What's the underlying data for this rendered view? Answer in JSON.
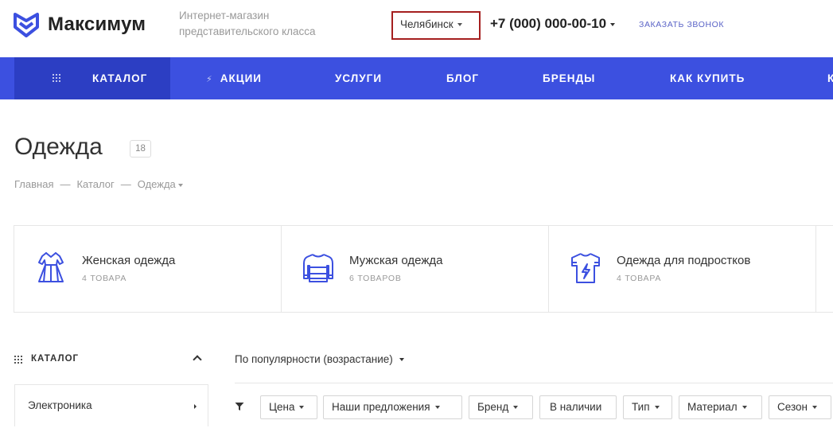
{
  "header": {
    "logo_text": "Максимум",
    "tagline": "Интернет-магазин представительского класса",
    "city": "Челябинск",
    "phone": "+7 (000) 000-00-10",
    "callback": "ЗАКАЗАТЬ ЗВОНОК"
  },
  "nav": {
    "items": [
      {
        "label": "КАТАЛОГ",
        "icon": "grid-icon"
      },
      {
        "label": "АКЦИИ",
        "icon": "lightning-icon"
      },
      {
        "label": "УСЛУГИ"
      },
      {
        "label": "БЛОГ"
      },
      {
        "label": "БРЕНДЫ"
      },
      {
        "label": "КАК КУПИТЬ"
      },
      {
        "label": "К"
      }
    ]
  },
  "page": {
    "title": "Одежда",
    "count": "18"
  },
  "breadcrumb": {
    "items": [
      "Главная",
      "Каталог",
      "Одежда"
    ],
    "separator": "—"
  },
  "categories": [
    {
      "title": "Женская одежда",
      "count": "4 ТОВАРА",
      "icon": "dress-icon"
    },
    {
      "title": "Мужская одежда",
      "count": "6 ТОВАРОВ",
      "icon": "sweater-icon"
    },
    {
      "title": "Одежда для подростков",
      "count": "4 ТОВАРА",
      "icon": "tshirt-icon"
    }
  ],
  "sidebar": {
    "title": "КАТАЛОГ",
    "items": [
      {
        "label": "Электроника"
      }
    ]
  },
  "sort": {
    "label": "По популярности (возрастание)"
  },
  "filters": [
    "Цена",
    "Наши предложения",
    "Бренд",
    "В наличии",
    "Тип",
    "Материал",
    "Сезон"
  ],
  "colors": {
    "nav_bg": "#3c50e0",
    "nav_active": "#2c3ec3",
    "accent": "#5b64c7",
    "city_border": "#a51f1f"
  }
}
